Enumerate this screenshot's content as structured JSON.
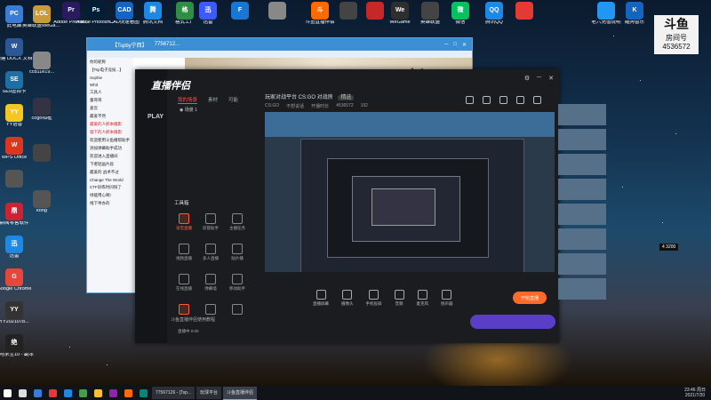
{
  "desktop": {
    "left_icons": [
      {
        "label": "此电脑",
        "color": "#3a7bd5",
        "glyph": "PC"
      },
      {
        "label": "新建 DOCX 文档",
        "color": "#2b5797",
        "glyph": "W"
      },
      {
        "label": "SE9虚拟卡",
        "color": "#1d6fa5",
        "glyph": "SE"
      },
      {
        "label": "YY语音",
        "color": "#f3c623",
        "glyph": "YY"
      },
      {
        "label": "WPS Office",
        "color": "#d9381e",
        "glyph": "W"
      },
      {
        "label": "",
        "color": "#555",
        "glyph": ""
      },
      {
        "label": "鼎阅零售软件",
        "color": "#c23",
        "glyph": "鼎"
      },
      {
        "label": "迅雷",
        "color": "#1e88e5",
        "glyph": "迅"
      },
      {
        "label": "Google Chrome",
        "color": "#e8453c",
        "glyph": "G"
      },
      {
        "label": "YY2021078...",
        "color": "#333",
        "glyph": "YY"
      },
      {
        "label": "绝地求生10 - 副本",
        "color": "#222",
        "glyph": "绝"
      }
    ],
    "col2_icons": [
      {
        "label": "英雄联盟WeGame",
        "color": "#c89b3c",
        "glyph": "LOL"
      },
      {
        "label": "ccd11e19...",
        "color": "#888",
        "glyph": ""
      },
      {
        "label": "cogo相框",
        "color": "#334",
        "glyph": ""
      },
      {
        "label": "",
        "color": "#444",
        "glyph": ""
      },
      {
        "label": "kong",
        "color": "#555",
        "glyph": ""
      }
    ],
    "top_icons": [
      {
        "label": "Adobe Premie...",
        "color": "#2a1a5e",
        "glyph": "Pr"
      },
      {
        "label": "Adobe Photosho...",
        "color": "#001e36",
        "glyph": "Ps"
      },
      {
        "label": "CAD快速看图",
        "color": "#1565c0",
        "glyph": "CAD"
      },
      {
        "label": "腾讯文档",
        "color": "#1e88e5",
        "glyph": "腾"
      },
      {
        "label": "格式工厂",
        "color": "#2c8f43",
        "glyph": "格"
      },
      {
        "label": "迅雷",
        "color": "#3d5afe",
        "glyph": "迅"
      },
      {
        "label": "",
        "color": "#1976d2",
        "glyph": "F"
      },
      {
        "label": "",
        "color": "#888",
        "glyph": ""
      },
      {
        "label": "斗鱼直播伴侣",
        "color": "#ff6a00",
        "glyph": "斗"
      },
      {
        "label": "",
        "color": "#444",
        "glyph": ""
      },
      {
        "label": "",
        "color": "#c62828",
        "glyph": ""
      },
      {
        "label": "WeGame",
        "color": "#2e2e2e",
        "glyph": "We"
      },
      {
        "label": "英雄联盟",
        "color": "#444",
        "glyph": ""
      },
      {
        "label": "微信",
        "color": "#07c160",
        "glyph": "微"
      },
      {
        "label": "腾讯QQ",
        "color": "#1e88e5",
        "glyph": "QQ"
      },
      {
        "label": "",
        "color": "#e53935",
        "glyph": ""
      },
      {
        "label": "老六充值说明",
        "color": "#2196f3",
        "glyph": ""
      },
      {
        "label": "酷狗音乐",
        "color": "#1565c0",
        "glyph": "K"
      }
    ],
    "room_badge": {
      "title": "斗鱼",
      "label": "房间号",
      "number": "4536572"
    }
  },
  "browser": {
    "title": "【Tspby宁西】",
    "tab2": "7756712...",
    "chat_lines": [
      {
        "text": "你的昵称",
        "red": false
      },
      {
        "text": "【Tsp电子竞技...】",
        "red": false
      },
      {
        "text": "Sophie",
        "red": false
      },
      {
        "text": "Whit",
        "red": false
      },
      {
        "text": "工具人",
        "red": false
      },
      {
        "text": "童哥哥",
        "red": false
      },
      {
        "text": "爱云",
        "red": false
      },
      {
        "text": "最爱不然",
        "red": false
      },
      {
        "text": "最爱的人抓本摄影",
        "red": true
      },
      {
        "text": "留下的人抓本摄影",
        "red": true
      },
      {
        "text": "欢迎使用斗鱼播帮助手",
        "red": false
      },
      {
        "text": "添加弹幕助手成功",
        "red": false
      },
      {
        "text": "欢迎进入直播间",
        "red": false
      },
      {
        "text": "下者轻画片段",
        "red": false
      },
      {
        "text": "最爱的 战术不过",
        "red": false
      },
      {
        "text": "Change The World",
        "red": false
      },
      {
        "text": "CTF训练时间快了",
        "red": false
      },
      {
        "text": "绿能用心啊!",
        "red": false
      },
      {
        "text": "线下举办的",
        "red": false
      }
    ],
    "banner_text": "剑网3"
  },
  "app": {
    "logo": "直播伴侣",
    "platform": "PLAY",
    "left_tabs": [
      "我的场景",
      "素材",
      "可能"
    ],
    "scene_label": "场景 1",
    "tools_title": "工具箱",
    "tools": [
      {
        "label": "语音直播",
        "red": true
      },
      {
        "label": "房管助手",
        "red": false
      },
      {
        "label": "主播任务",
        "red": false
      },
      {
        "label": "视频直播",
        "red": false
      },
      {
        "label": "多人直播",
        "red": false
      },
      {
        "label": "贴片播",
        "red": false
      },
      {
        "label": "在线直播",
        "red": false
      },
      {
        "label": "弹幕墙",
        "red": false
      },
      {
        "label": "移动助手",
        "red": false
      },
      {
        "label": "",
        "red": true
      },
      {
        "label": "",
        "red": false
      },
      {
        "label": "",
        "red": false
      }
    ],
    "left_status": "斗鱼直播伴侣使用教程",
    "room_title": "玩家对战平台 CS:GO 对战房",
    "room_badge": "精选",
    "sub": [
      "CS:GO",
      "不想说话",
      "开播时长",
      "4536572",
      "192"
    ],
    "controls": [
      "直播屏幕",
      "摄像头",
      "手机投屏",
      "音频",
      "麦克风",
      "扬声器"
    ],
    "start_label": "开始直播",
    "status": "直播中 0:00"
  },
  "overlay": {
    "left_num": "4",
    "right_num": "3200"
  },
  "taskbar": {
    "tasks": [
      {
        "label": "77567126 - [Tsp...",
        "active": false
      },
      {
        "label": "玩球平台",
        "active": false
      },
      {
        "label": "斗鱼直播伴侣",
        "active": true
      }
    ],
    "time": "23:46",
    "day": "周日",
    "date": "2021/7/20"
  }
}
